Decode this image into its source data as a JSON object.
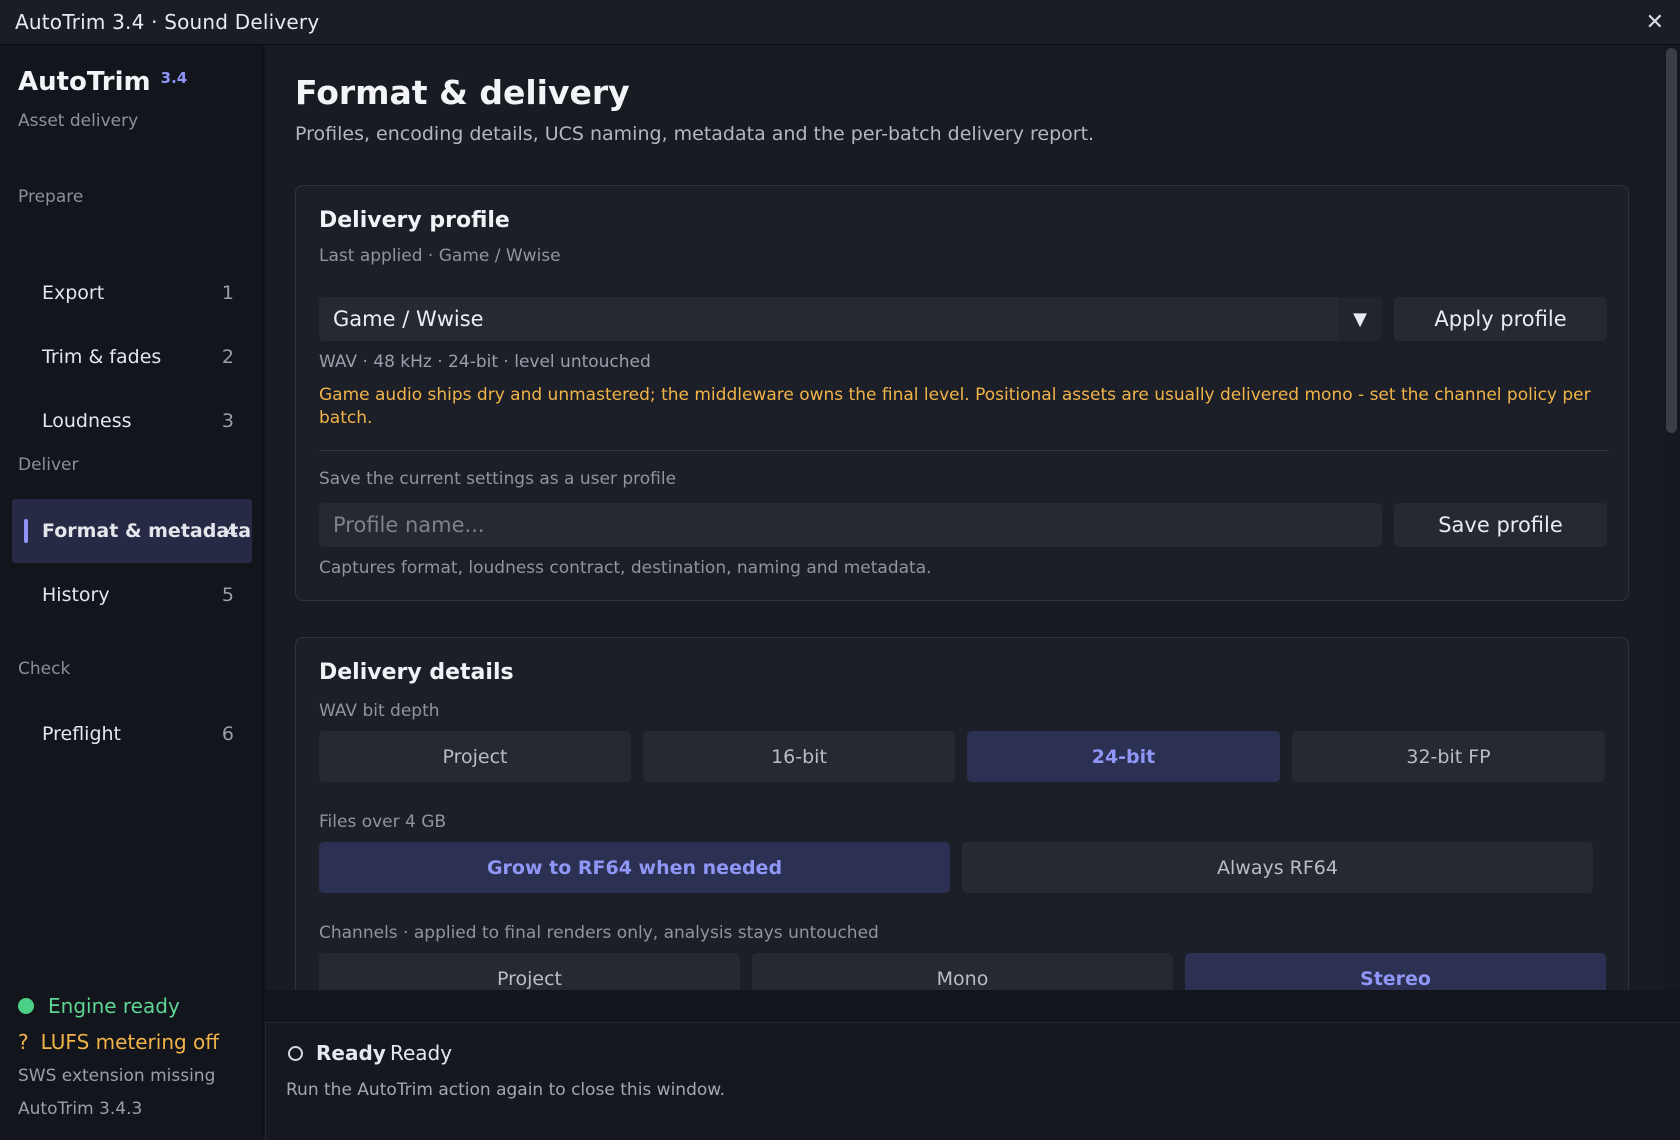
{
  "window": {
    "title": "AutoTrim 3.4 · Sound Delivery"
  },
  "sidebar": {
    "brand_name": "AutoTrim",
    "brand_version": "3.4",
    "brand_sub": "Asset delivery",
    "sections": {
      "prepare": "Prepare",
      "deliver": "Deliver",
      "check": "Check"
    },
    "items": [
      {
        "label": "Export",
        "num": "1"
      },
      {
        "label": "Trim & fades",
        "num": "2"
      },
      {
        "label": "Loudness",
        "num": "3"
      },
      {
        "label": "Format & metadata",
        "num": "4",
        "active": true
      },
      {
        "label": "History",
        "num": "5"
      },
      {
        "label": "Preflight",
        "num": "6"
      }
    ],
    "engine_status": "Engine ready",
    "lufs_status": "LUFS metering off",
    "lufs_icon": "?",
    "sws_status": "SWS extension missing",
    "app_version": "AutoTrim 3.4.3"
  },
  "main": {
    "title": "Format & delivery",
    "subtitle": "Profiles, encoding details, UCS naming, metadata and the per-batch delivery report.",
    "profile_card": {
      "title": "Delivery profile",
      "last_applied": "Last applied · Game / Wwise",
      "selected_profile": "Game / Wwise",
      "apply_label": "Apply profile",
      "format_summary": "WAV · 48 kHz · 24-bit · level untouched",
      "warning": "Game audio ships dry and unmastered; the middleware owns the final level. Positional assets are usually delivered mono - set the channel policy per batch.",
      "save_caption": "Save the current settings as a user profile",
      "profile_name_placeholder": "Profile name...",
      "save_label": "Save profile",
      "save_note": "Captures format, loudness contract, destination, naming and metadata."
    },
    "details_card": {
      "title": "Delivery details",
      "bit_depth_label": "WAV bit depth",
      "bit_depth_options": [
        "Project",
        "16-bit",
        "24-bit",
        "32-bit FP"
      ],
      "bit_depth_selected": "24-bit",
      "large_files_label": "Files over 4 GB",
      "large_files_options": [
        "Grow to RF64 when needed",
        "Always RF64"
      ],
      "large_files_selected": "Grow to RF64 when needed",
      "channels_label": "Channels · applied to final renders only, analysis stays untouched",
      "channels_options": [
        "Project",
        "Mono",
        "Stereo"
      ],
      "channels_selected": "Stereo"
    }
  },
  "status": {
    "state": "Ready",
    "message": "Ready",
    "hint": "Run the AutoTrim action again to close this window."
  },
  "colors": {
    "accent": "#8e95f5",
    "ok": "#5ed594",
    "warn": "#f0b348",
    "bg": "#13151c"
  }
}
